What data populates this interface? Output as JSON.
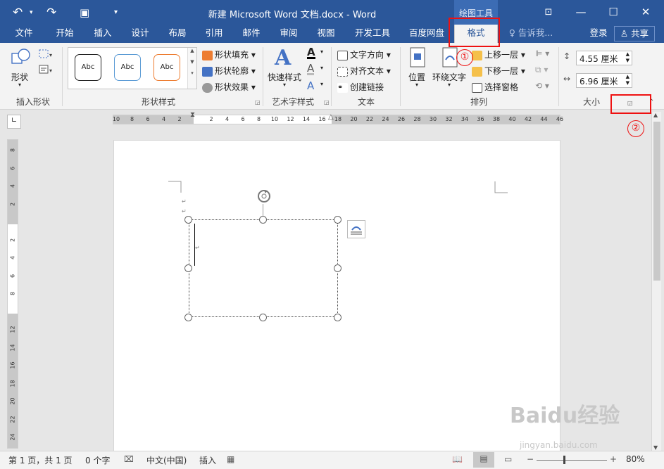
{
  "titlebar": {
    "doc_title": "新建 Microsoft Word 文档.docx - Word",
    "context_title": "绘图工具",
    "undo_icon": "undo-icon",
    "redo_icon": "redo-icon",
    "save_icon": "save-icon"
  },
  "tabs": [
    {
      "label": "文件"
    },
    {
      "label": "开始"
    },
    {
      "label": "插入"
    },
    {
      "label": "设计"
    },
    {
      "label": "布局"
    },
    {
      "label": "引用"
    },
    {
      "label": "邮件"
    },
    {
      "label": "审阅"
    },
    {
      "label": "视图"
    },
    {
      "label": "开发工具"
    },
    {
      "label": "百度网盘"
    },
    {
      "label": "格式"
    }
  ],
  "tellme": "♀ 告诉我...",
  "account": {
    "login": "登录",
    "share": "共享"
  },
  "ribbon": {
    "insert_shape": {
      "shape_label": "形状",
      "group_label": "插入形状"
    },
    "shape_styles": {
      "abc": [
        "Abc",
        "Abc",
        "Abc"
      ],
      "fill": "形状填充",
      "outline": "形状轮廓",
      "effects": "形状效果",
      "group_label": "形状样式"
    },
    "wordart": {
      "quick_styles": "快速样式",
      "group_label": "艺术字样式"
    },
    "text": {
      "direction": "文字方向",
      "align": "对齐文本",
      "link": "创建链接",
      "group_label": "文本"
    },
    "arrange": {
      "position": "位置",
      "wrap": "环绕文字",
      "bring_forward": "上移一层",
      "send_backward": "下移一层",
      "selection_pane": "选择窗格",
      "group_label": "排列"
    },
    "size": {
      "height": "4.55 厘米",
      "width": "6.96 厘米",
      "group_label": "大小"
    }
  },
  "annotations": {
    "marker1": "①",
    "marker2": "②"
  },
  "ruler_h": [
    "10",
    "8",
    "6",
    "4",
    "2",
    "",
    "2",
    "4",
    "6",
    "8",
    "10",
    "12",
    "14",
    "16",
    "18",
    "20",
    "22",
    "24",
    "26",
    "28",
    "30",
    "32",
    "34",
    "36",
    "38",
    "40",
    "42",
    "44",
    "46"
  ],
  "ruler_v": [
    "8",
    "6",
    "4",
    "2",
    "",
    "2",
    "4",
    "6",
    "8",
    "",
    "12",
    "14",
    "16",
    "18",
    "20",
    "22",
    "24"
  ],
  "status": {
    "page": "第 1 页，共 1 页",
    "words": "0 个字",
    "language": "中文(中国)",
    "mode": "插入",
    "zoom": "80%"
  },
  "watermark": {
    "brand": "Baidu经验",
    "url": "jingyan.baidu.com"
  },
  "colors": {
    "brand": "#2b579a",
    "annotation": "#e11111"
  }
}
